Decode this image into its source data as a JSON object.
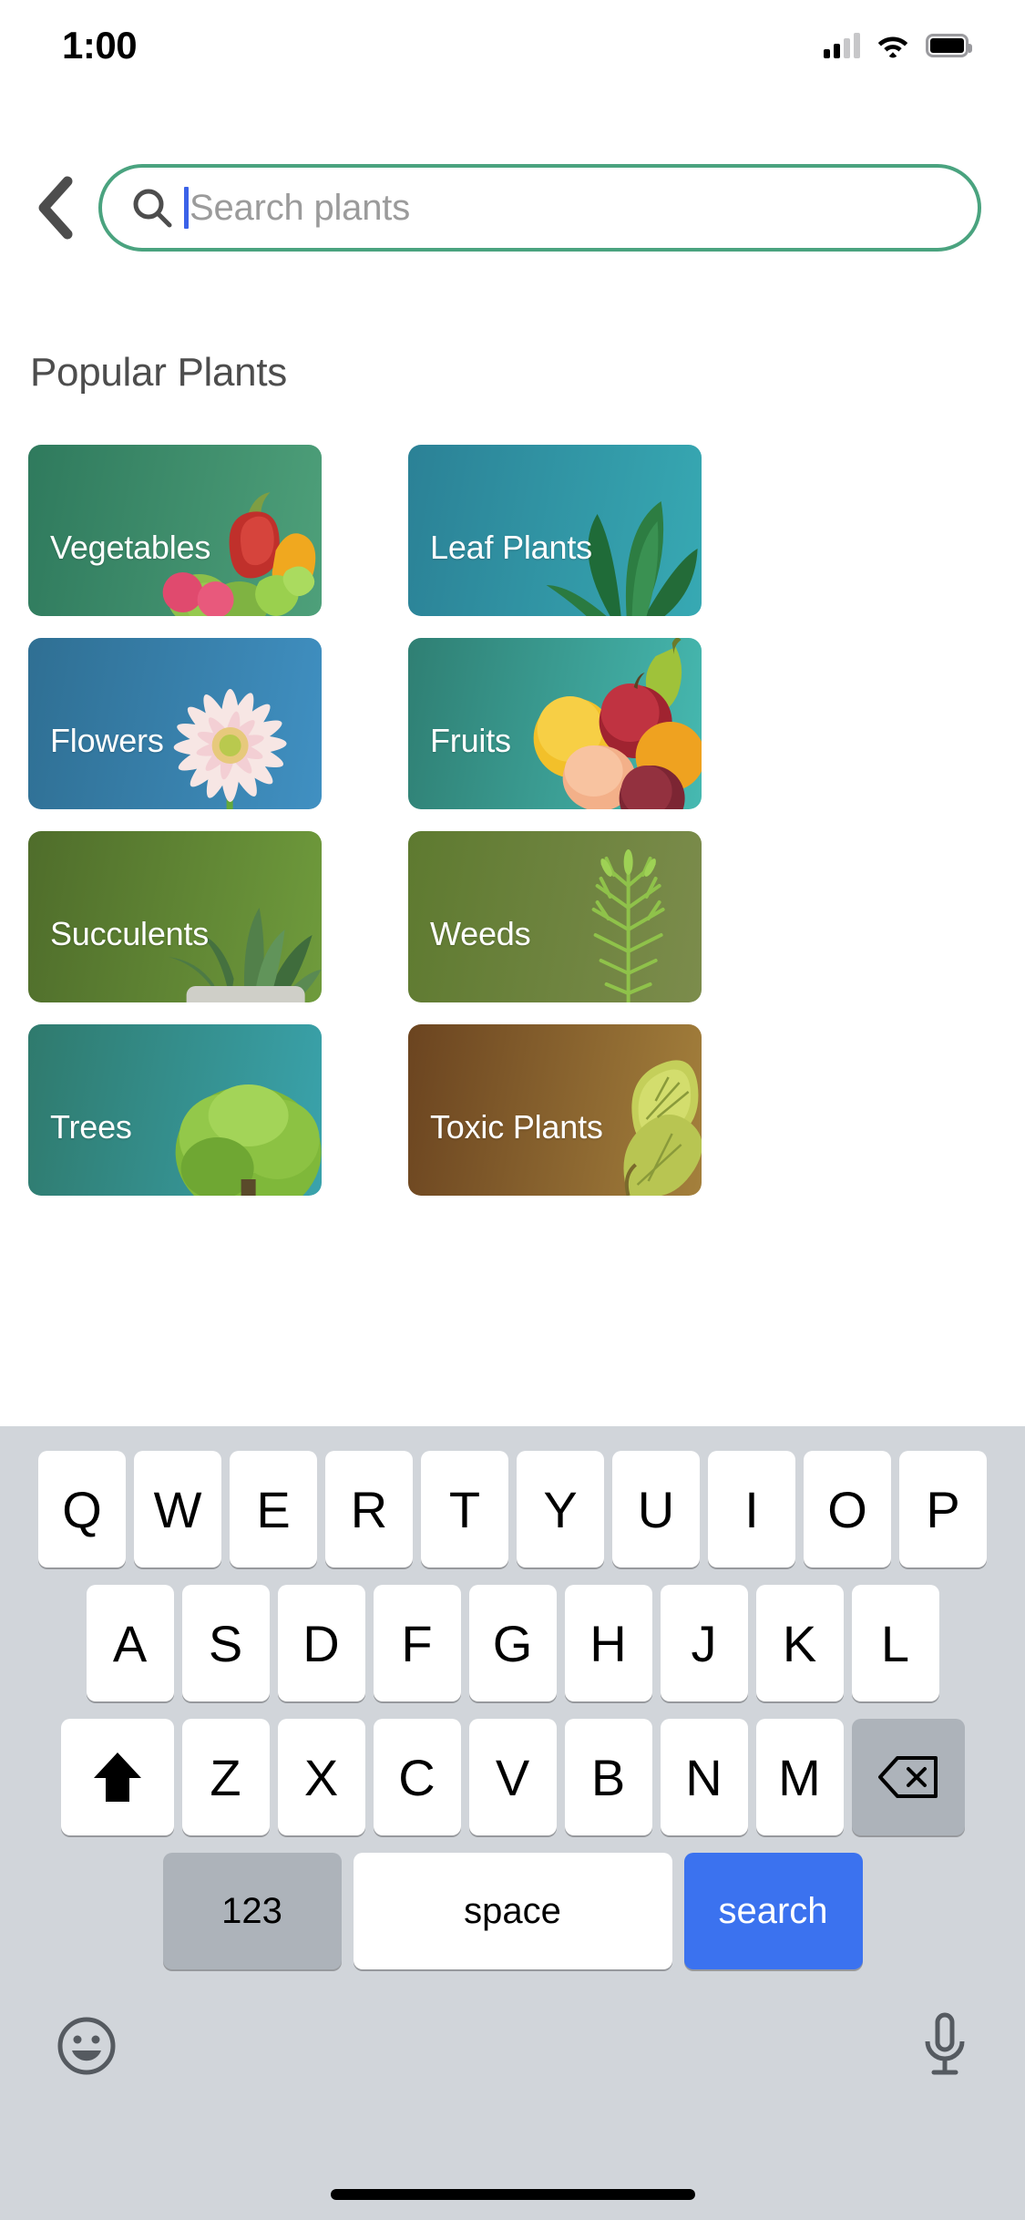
{
  "status_bar": {
    "time": "1:00",
    "cellular_icon": "signal-bars-icon",
    "wifi_icon": "wifi-icon",
    "battery_icon": "battery-icon"
  },
  "header": {
    "back_icon": "chevron-left-icon",
    "search": {
      "icon": "search-icon",
      "value": "",
      "placeholder": "Search plants",
      "border_color": "#4aa37f",
      "caret_color": "#3b62e8"
    }
  },
  "main": {
    "section_title": "Popular Plants",
    "categories": [
      {
        "label": "Vegetables",
        "art": "vegetables",
        "gradient_from": "#2f7a5d",
        "gradient_to": "#4ea07a"
      },
      {
        "label": "Leaf Plants",
        "art": "leaf",
        "gradient_from": "#2b8196",
        "gradient_to": "#37a9b3"
      },
      {
        "label": "Flowers",
        "art": "flower",
        "gradient_from": "#2f6f93",
        "gradient_to": "#4090c2"
      },
      {
        "label": "Fruits",
        "art": "fruits",
        "gradient_from": "#2f7f73",
        "gradient_to": "#46b9b1"
      },
      {
        "label": "Succulents",
        "art": "succulent",
        "gradient_from": "#4f6d2b",
        "gradient_to": "#6f9b3c"
      },
      {
        "label": "Weeds",
        "art": "weed",
        "gradient_from": "#5e7a30",
        "gradient_to": "#7c8c4c"
      },
      {
        "label": "Trees",
        "art": "tree",
        "gradient_from": "#2f7a6d",
        "gradient_to": "#3aa3ac"
      },
      {
        "label": "Toxic Plants",
        "art": "toxic-leaf",
        "gradient_from": "#6b4420",
        "gradient_to": "#a4803c"
      }
    ]
  },
  "keyboard": {
    "row1": [
      "Q",
      "W",
      "E",
      "R",
      "T",
      "Y",
      "U",
      "I",
      "O",
      "P"
    ],
    "row2": [
      "A",
      "S",
      "D",
      "F",
      "G",
      "H",
      "J",
      "K",
      "L"
    ],
    "row3_letters": [
      "Z",
      "X",
      "C",
      "V",
      "B",
      "N",
      "M"
    ],
    "shift_icon": "shift-up-arrow-icon",
    "backspace_icon": "backspace-delete-icon",
    "numeric_key": "123",
    "space_key": "space",
    "return_key": "search",
    "return_key_color": "#3b72ef",
    "emoji_icon": "emoji-smiley-icon",
    "dictation_icon": "microphone-icon"
  }
}
